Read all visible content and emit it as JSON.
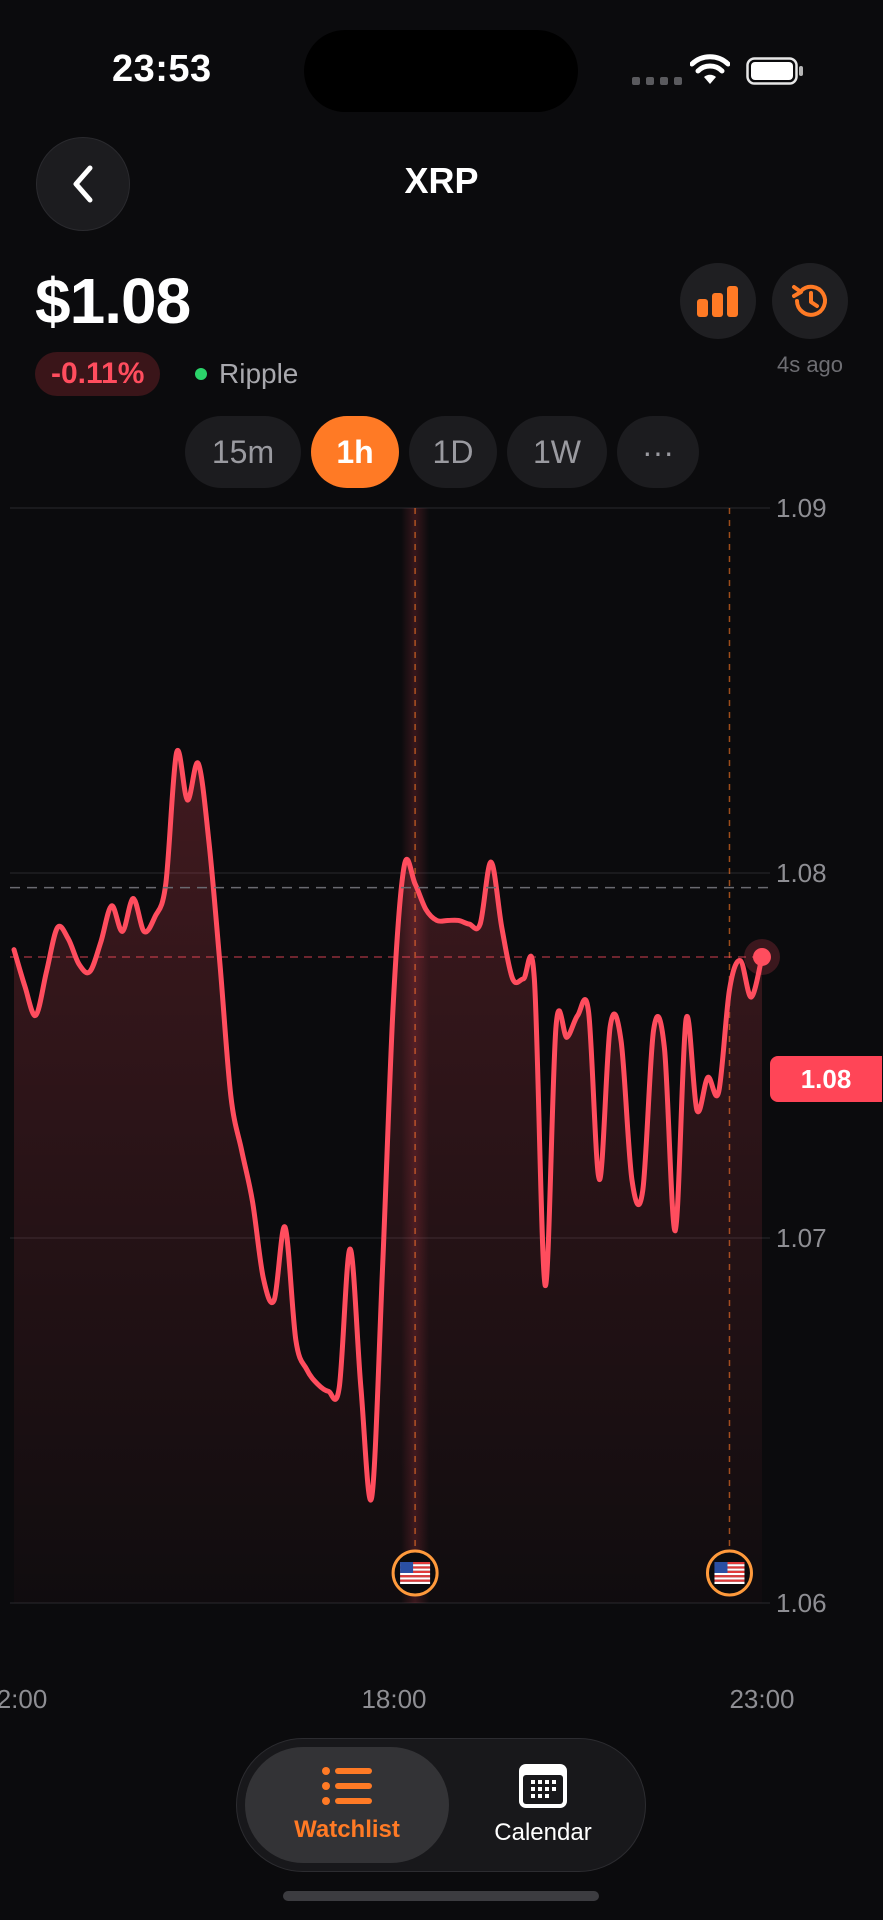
{
  "status_bar": {
    "time": "23:53"
  },
  "header": {
    "title": "XRP"
  },
  "quote": {
    "price": "$1.08",
    "change": "-0.11%",
    "source": "Ripple",
    "updated": "4s ago"
  },
  "tabs": [
    {
      "label": "15m",
      "active": false
    },
    {
      "label": "1h",
      "active": true
    },
    {
      "label": "1D",
      "active": false
    },
    {
      "label": "1W",
      "active": false
    },
    {
      "label": "···",
      "active": false
    }
  ],
  "icons": {
    "back": "chevron-left-icon",
    "chart_type": "bar-chart-icon",
    "history": "history-icon",
    "event": "us-flag-icon",
    "watchlist": "list-icon",
    "calendar": "calendar-icon"
  },
  "colors": {
    "accent": "#ff7a25",
    "line": "#ff4d5e",
    "positive": "#2bd46a",
    "background": "#0b0b0d"
  },
  "chart_data": {
    "type": "line",
    "y_ticks": [
      "1.09",
      "1.08",
      "1.07",
      "1.06"
    ],
    "ylim": [
      1.06,
      1.09
    ],
    "x_ticks": [
      "2:00",
      "18:00",
      "23:00"
    ],
    "last_price_label": "1.08",
    "last_price": 1.0777,
    "reference_price": 1.0796,
    "series": [
      {
        "values": [
          1.0779,
          1.0769,
          1.0761,
          1.0773,
          1.0785,
          1.0782,
          1.0775,
          1.0773,
          1.0781,
          1.0791,
          1.0784,
          1.0793,
          1.0784,
          1.0788,
          1.0797,
          1.0833,
          1.082,
          1.083,
          1.0808,
          1.0775,
          1.0739,
          1.0724,
          1.071,
          1.0689,
          1.0683,
          1.0703,
          1.0672,
          1.0664,
          1.066,
          1.0658,
          1.0659,
          1.0697,
          1.0659,
          1.0629,
          1.0692,
          1.0765,
          1.0802,
          1.0797,
          1.079,
          1.0787,
          1.0787,
          1.0787,
          1.0786,
          1.0786,
          1.0803,
          1.0785,
          1.0771,
          1.0771,
          1.0771,
          1.0687,
          1.0758,
          1.0755,
          1.0761,
          1.0762,
          1.0716,
          1.0758,
          1.0754,
          1.0716,
          1.0713,
          1.0757,
          1.0752,
          1.0702,
          1.076,
          1.0735,
          1.0744,
          1.074,
          1.0768,
          1.0776,
          1.0766,
          1.0777
        ]
      }
    ],
    "events": [
      {
        "x_index": 37,
        "icon": "us-flag-icon"
      },
      {
        "x_index": 66,
        "icon": "us-flag-icon"
      }
    ]
  },
  "nav": {
    "watchlist": "Watchlist",
    "calendar": "Calendar"
  }
}
